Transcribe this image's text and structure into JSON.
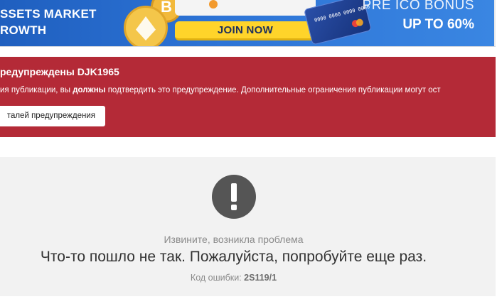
{
  "banner": {
    "left_line1": "SSETS MARKET",
    "left_line2": "ROWTH",
    "coin_symbol": "B",
    "join_label": "JOIN NOW",
    "card_number": "0000 0000 0000 0000",
    "right_line1": "PRE ICO BONUS",
    "right_line2": "UP TO 60%",
    "colors": {
      "background": "#2d74d6",
      "button": "#ffd42a",
      "coin": "#f4c64a"
    }
  },
  "warning": {
    "title": "редупреждены DJK1965",
    "text_before": "ия публикации, вы ",
    "text_bold": "должны",
    "text_after": " подтвердить это предупреждение. Дополнительные ограничения публикации могут ост",
    "details_button": "талей предупреждения",
    "colors": {
      "background": "#b42a37"
    }
  },
  "error": {
    "icon": "exclamation-circle-icon",
    "subtitle": "Извините, возникла проблема",
    "message": "Что-то пошло не так. Пожалуйста, попробуйте еще раз.",
    "code_label": "Код ошибки: ",
    "code_value": "2S119/1",
    "colors": {
      "background": "#f2f2f2",
      "icon": "#555555"
    }
  }
}
